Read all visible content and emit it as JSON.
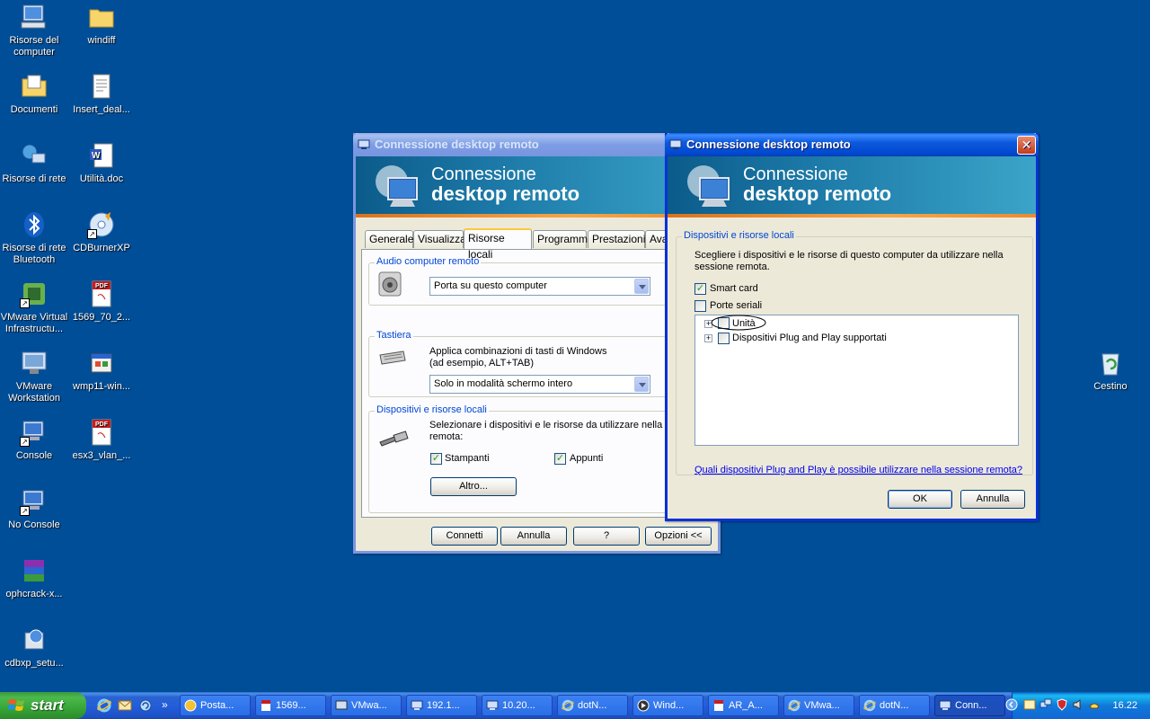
{
  "desktop": {
    "icons": [
      {
        "label": "Risorse del computer",
        "icon": "my-computer-icon"
      },
      {
        "label": "windiff",
        "icon": "folder-icon"
      },
      {
        "label": "Documenti",
        "icon": "my-documents-icon"
      },
      {
        "label": "Insert_deal...",
        "icon": "text-file-icon"
      },
      {
        "label": "Risorse di rete",
        "icon": "network-places-icon"
      },
      {
        "label": "Utilità.doc",
        "icon": "word-doc-icon"
      },
      {
        "label": "Risorse di rete Bluetooth",
        "icon": "bluetooth-icon"
      },
      {
        "label": "CDBurnerXP",
        "icon": "cdburner-icon"
      },
      {
        "label": "VMware Virtual Infrastructu...",
        "icon": "vmware-vi-icon"
      },
      {
        "label": "1569_70_2...",
        "icon": "pdf-icon"
      },
      {
        "label": "VMware Workstation",
        "icon": "vmware-workstation-icon"
      },
      {
        "label": "wmp11-win...",
        "icon": "installer-icon"
      },
      {
        "label": "Console",
        "icon": "remote-desktop-icon"
      },
      {
        "label": "esx3_vlan_...",
        "icon": "pdf-icon"
      },
      {
        "label": "No Console",
        "icon": "remote-desktop-icon"
      },
      {
        "label": "ophcrack-x...",
        "icon": "winrar-icon"
      },
      {
        "label": "cdbxp_setu...",
        "icon": "setup-icon"
      },
      {
        "label": "Cestino",
        "icon": "recycle-bin-icon"
      }
    ]
  },
  "main_window": {
    "title": "Connessione desktop remoto",
    "banner_line1": "Connessione",
    "banner_line2": "desktop remoto",
    "tabs": [
      "Generale",
      "Visualizza",
      "Risorse locali",
      "Programmi",
      "Prestazioni",
      "Ava"
    ],
    "active_tab": "Risorse locali",
    "audio_group": "Audio computer remoto",
    "audio_value": "Porta su questo computer",
    "keyboard_group": "Tastiera",
    "keyboard_desc_1": "Applica combinazioni di tasti di Windows",
    "keyboard_desc_2": "(ad esempio, ALT+TAB)",
    "keyboard_value": "Solo in modalità schermo intero",
    "devices_group": "Dispositivi e risorse locali",
    "devices_desc_1": "Selezionare i dispositivi e le risorse da utilizzare nella sess",
    "devices_desc_2": "remota:",
    "printers_label": "Stampanti",
    "clipboard_label": "Appunti",
    "more_button": "Altro...",
    "connect_button": "Connetti",
    "cancel_button": "Annulla",
    "help_button": "?",
    "options_button": "Opzioni <<"
  },
  "dialog": {
    "title": "Connessione desktop remoto",
    "banner_line1": "Connessione",
    "banner_line2": "desktop remoto",
    "group": "Dispositivi e risorse locali",
    "desc_1": "Scegliere i dispositivi e le risorse di questo computer da utilizzare nella",
    "desc_2": "sessione remota.",
    "smartcard_label": "Smart card",
    "smartcard_checked": true,
    "serial_label": "Porte seriali",
    "serial_checked": false,
    "tree_items": [
      "Unità",
      "Dispositivi Plug and Play supportati"
    ],
    "link": "Quali dispositivi Plug and Play è possibile utilizzare nella sessione remota?",
    "ok_button": "OK",
    "cancel_button": "Annulla"
  },
  "taskbar": {
    "start_label": "start",
    "overflow": "»",
    "buttons": [
      {
        "label": "Posta...",
        "icon": "outlook-icon"
      },
      {
        "label": "1569...",
        "icon": "pdf-icon"
      },
      {
        "label": "VMwa...",
        "icon": "vmware-icon"
      },
      {
        "label": "192.1...",
        "icon": "remote-desktop-icon"
      },
      {
        "label": "10.20...",
        "icon": "remote-desktop-icon"
      },
      {
        "label": "dotN...",
        "icon": "ie-icon"
      },
      {
        "label": "Wind...",
        "icon": "media-player-icon"
      },
      {
        "label": "AR_A...",
        "icon": "pdf-icon"
      },
      {
        "label": "VMwa...",
        "icon": "ie-icon"
      },
      {
        "label": "dotN...",
        "icon": "ie-icon"
      },
      {
        "label": "Conn...",
        "icon": "remote-desktop-icon"
      }
    ],
    "clock": "16.22"
  }
}
